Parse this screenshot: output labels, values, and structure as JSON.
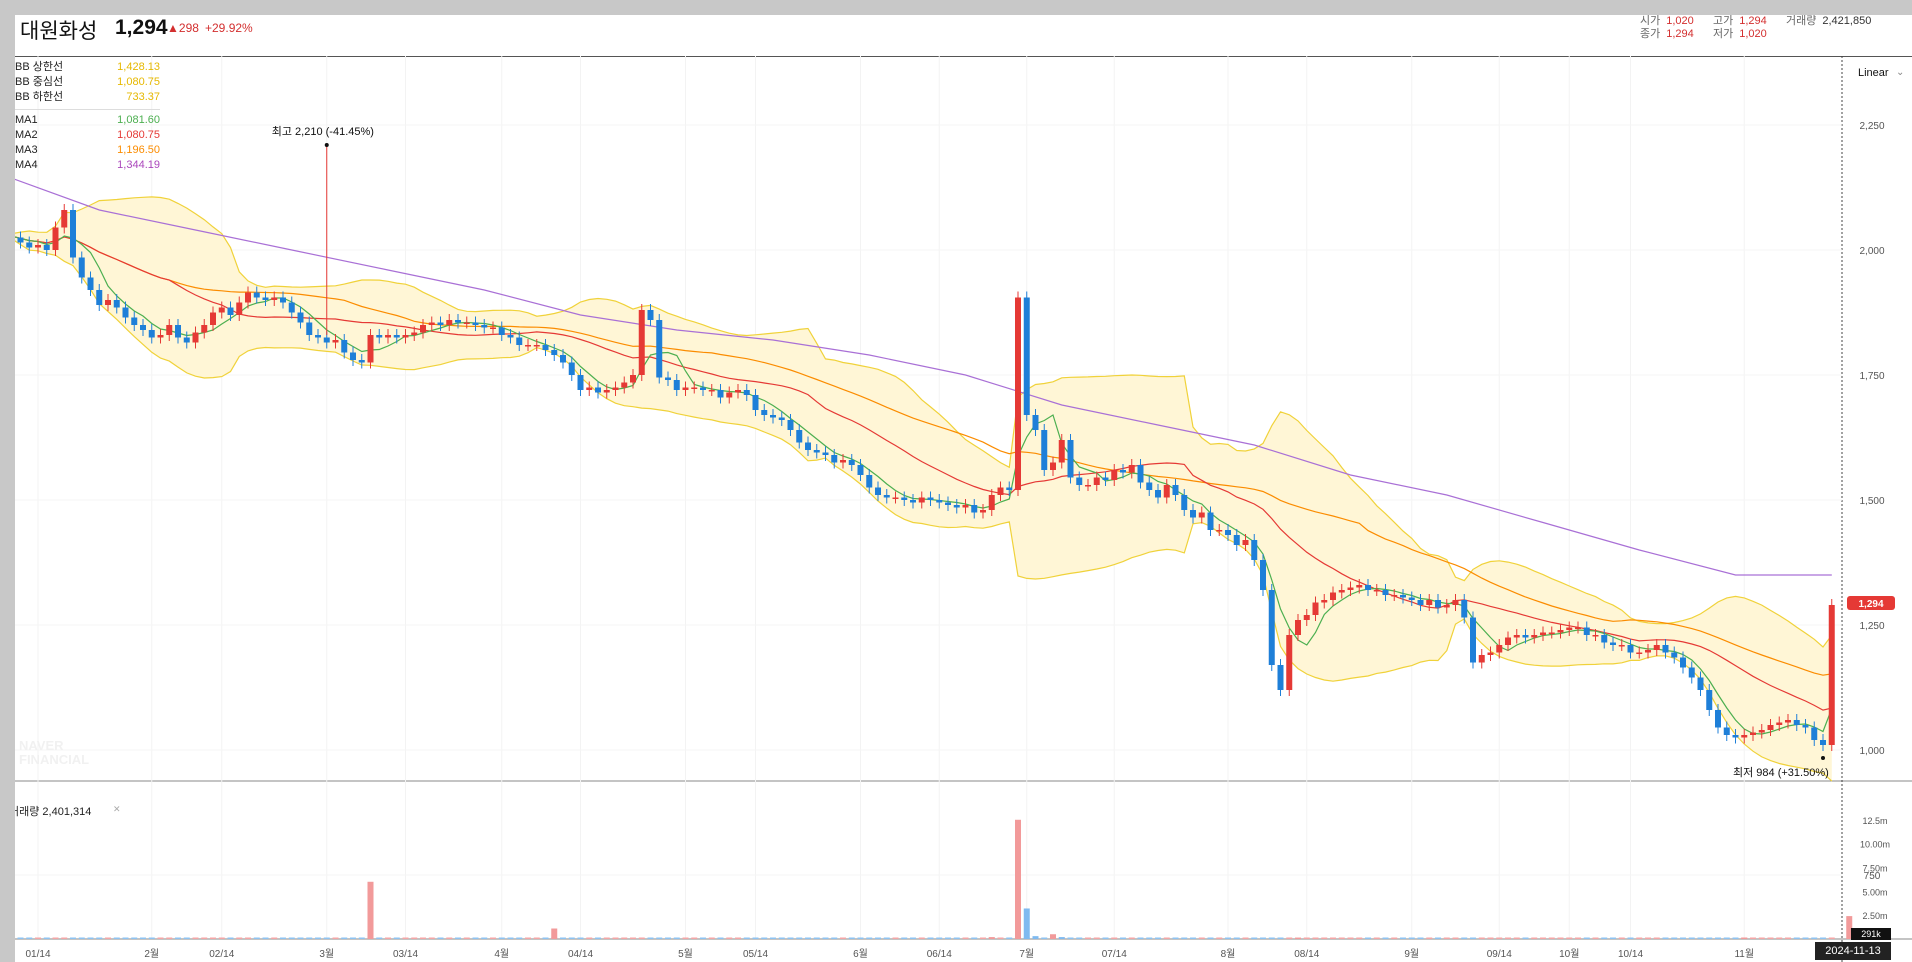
{
  "header": {
    "name": "대원화성",
    "price": "1,294",
    "change": "298",
    "change_pct": "+29.92%",
    "stats": [
      {
        "label": "시가",
        "value": "1,020"
      },
      {
        "label": "고가",
        "value": "1,294"
      },
      {
        "label": "거래량",
        "value": "2,421,850"
      },
      {
        "label": "종가",
        "value": "1,294"
      },
      {
        "label": "저가",
        "value": "1,020"
      }
    ]
  },
  "legend": {
    "bb": [
      {
        "label": "BB 상한선",
        "value": "1,428.13",
        "color": "#e6b800"
      },
      {
        "label": "BB 중심선",
        "value": "1,080.75",
        "color": "#e6b800"
      },
      {
        "label": "BB 하한선",
        "value": "733.37",
        "color": "#e6b800"
      }
    ],
    "ma": [
      {
        "label": "MA1",
        "value": "1,081.60",
        "color": "#4caf50"
      },
      {
        "label": "MA2",
        "value": "1,080.75",
        "color": "#e53935"
      },
      {
        "label": "MA3",
        "value": "1,196.50",
        "color": "#fb8c00"
      },
      {
        "label": "MA4",
        "value": "1,344.19",
        "color": "#ab47bc"
      }
    ]
  },
  "scale_mode": "Linear",
  "volume_label": "거래량 2,401,314",
  "watermark": "NAVER FINANCIAL",
  "last_price_tag": "1,294",
  "last_volume_tag": "291k",
  "date_tag": "2024-11-13",
  "annotations": {
    "high": "최고 2,210 (-41.45%)",
    "low": "최저 984 (+31.50%)"
  },
  "colors": {
    "up": "#e53935",
    "down": "#1e7fd8",
    "band": "#fff6d6",
    "band_line": "#f0d23a"
  },
  "chart_data": {
    "type": "candlestick",
    "xlabel": "",
    "ylabel": "",
    "ylim": [
      650,
      2400
    ],
    "y_ticks": [
      750,
      1000,
      1250,
      1500,
      1750,
      2000,
      2250
    ],
    "y_tick_labels": [
      "750",
      "1,000",
      "1,250",
      "1,500",
      "1,750",
      "2,000",
      "2,250"
    ],
    "x_ticks": [
      {
        "label": "01/14",
        "i": 4
      },
      {
        "label": "2월",
        "i": 17
      },
      {
        "label": "02/14",
        "i": 25
      },
      {
        "label": "3월",
        "i": 37
      },
      {
        "label": "03/14",
        "i": 46
      },
      {
        "label": "4월",
        "i": 57
      },
      {
        "label": "04/14",
        "i": 66
      },
      {
        "label": "5월",
        "i": 78
      },
      {
        "label": "05/14",
        "i": 86
      },
      {
        "label": "6월",
        "i": 98
      },
      {
        "label": "06/14",
        "i": 107
      },
      {
        "label": "7월",
        "i": 117
      },
      {
        "label": "07/14",
        "i": 127
      },
      {
        "label": "8월",
        "i": 140
      },
      {
        "label": "08/14",
        "i": 149
      },
      {
        "label": "9월",
        "i": 161
      },
      {
        "label": "09/14",
        "i": 171
      },
      {
        "label": "10월",
        "i": 179
      },
      {
        "label": "10/14",
        "i": 186
      },
      {
        "label": "11월",
        "i": 199
      }
    ],
    "close": [
      2030,
      2025,
      2015,
      2005,
      2010,
      2000,
      2045,
      2080,
      1985,
      1945,
      1920,
      1890,
      1900,
      1885,
      1865,
      1850,
      1840,
      1825,
      1830,
      1850,
      1825,
      1815,
      1835,
      1850,
      1875,
      1885,
      1870,
      1895,
      1915,
      1905,
      1900,
      1905,
      1895,
      1875,
      1855,
      1830,
      1825,
      1815,
      1820,
      1795,
      1780,
      1775,
      1830,
      1825,
      1830,
      1825,
      1830,
      1835,
      1850,
      1855,
      1850,
      1860,
      1855,
      1855,
      1850,
      1845,
      1845,
      1830,
      1825,
      1810,
      1810,
      1810,
      1800,
      1790,
      1775,
      1750,
      1720,
      1725,
      1715,
      1720,
      1725,
      1735,
      1750,
      1880,
      1860,
      1745,
      1740,
      1720,
      1725,
      1725,
      1720,
      1720,
      1705,
      1715,
      1720,
      1710,
      1680,
      1670,
      1665,
      1660,
      1640,
      1615,
      1600,
      1595,
      1590,
      1575,
      1580,
      1570,
      1550,
      1525,
      1510,
      1505,
      1505,
      1500,
      1495,
      1505,
      1500,
      1495,
      1490,
      1485,
      1490,
      1475,
      1480,
      1510,
      1525,
      1520,
      1905,
      1670,
      1640,
      1560,
      1575,
      1620,
      1545,
      1530,
      1530,
      1545,
      1540,
      1560,
      1555,
      1570,
      1535,
      1520,
      1505,
      1530,
      1510,
      1480,
      1465,
      1475,
      1440,
      1440,
      1430,
      1410,
      1420,
      1380,
      1320,
      1170,
      1120,
      1230,
      1260,
      1270,
      1295,
      1300,
      1315,
      1320,
      1325,
      1330,
      1320,
      1320,
      1310,
      1310,
      1305,
      1300,
      1290,
      1300,
      1285,
      1290,
      1300,
      1265,
      1175,
      1190,
      1195,
      1210,
      1225,
      1230,
      1225,
      1230,
      1235,
      1235,
      1240,
      1245,
      1245,
      1230,
      1230,
      1215,
      1210,
      1210,
      1195,
      1195,
      1200,
      1210,
      1195,
      1185,
      1165,
      1145,
      1120,
      1080,
      1045,
      1030,
      1025,
      1030,
      1035,
      1040,
      1050,
      1055,
      1060,
      1050,
      1045,
      1020,
      1010,
      1290
    ],
    "ma4": [
      2150,
      2080,
      2040,
      2000,
      1960,
      1920,
      1870,
      1840,
      1820,
      1790,
      1750,
      1690,
      1650,
      1610,
      1550,
      1510,
      1455,
      1400,
      1350,
      1350
    ],
    "volume_max": 13000000,
    "volume_ticks": [
      "2.50m",
      "5.00m",
      "7.50m",
      "10.00m",
      "12.5m"
    ],
    "volume_spikes": [
      {
        "i": 42,
        "v": 6000000,
        "dir": "up"
      },
      {
        "i": 63,
        "v": 1100000,
        "dir": "up"
      },
      {
        "i": 113,
        "v": 200000,
        "dir": "up"
      },
      {
        "i": 116,
        "v": 12500000,
        "dir": "up"
      },
      {
        "i": 117,
        "v": 3200000,
        "dir": "down"
      },
      {
        "i": 118,
        "v": 300000,
        "dir": "down"
      },
      {
        "i": 120,
        "v": 500000,
        "dir": "up"
      },
      {
        "i": 121,
        "v": 200000,
        "dir": "down"
      },
      {
        "i": 148,
        "v": 100000,
        "dir": "up"
      },
      {
        "i": 199,
        "v": 150000,
        "dir": "up"
      },
      {
        "i": 211,
        "v": 2400000,
        "dir": "up"
      }
    ]
  }
}
